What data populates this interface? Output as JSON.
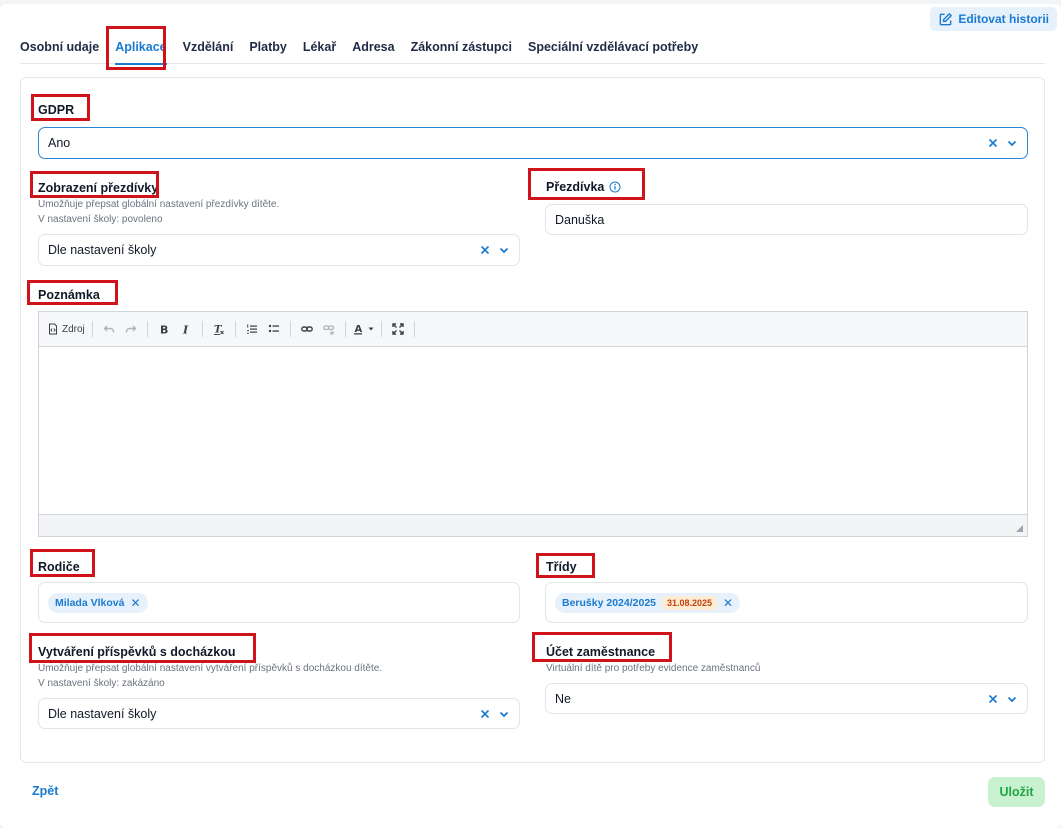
{
  "header": {
    "edit_history_label": "Editovat historii"
  },
  "tabs": [
    {
      "label": "Osobní udaje",
      "active": false
    },
    {
      "label": "Aplikace",
      "active": true
    },
    {
      "label": "Vzdělání",
      "active": false
    },
    {
      "label": "Platby",
      "active": false
    },
    {
      "label": "Lékař",
      "active": false
    },
    {
      "label": "Adresa",
      "active": false
    },
    {
      "label": "Zákonní zástupci",
      "active": false
    },
    {
      "label": "Speciální vzdělávací potřeby",
      "active": false
    }
  ],
  "gdpr": {
    "label": "GDPR",
    "value": "Ano"
  },
  "nickname_display": {
    "label": "Zobrazení přezdívky",
    "hint1": "Umožňuje přepsat globální nastavení přezdívky dítěte.",
    "hint2": "V nastavení školy: povoleno",
    "value": "Dle nastavení školy"
  },
  "nickname": {
    "label": "Přezdívka",
    "value": "Danuška"
  },
  "note": {
    "label": "Poznámka",
    "toolbar_source_label": "Zdroj",
    "content": ""
  },
  "parents": {
    "label": "Rodiče",
    "chips": [
      "Milada Vlková"
    ]
  },
  "classes": {
    "label": "Třídy",
    "chip_label": "Berušky 2024/2025",
    "chip_date": "31.08.2025"
  },
  "attendance_posts": {
    "label": "Vytváření příspěvků s docházkou",
    "hint1": "Umožňuje přepsat globální nastavení vytváření příspěvků s docházkou dítěte.",
    "hint2": "V nastavení školy: zakázáno",
    "value": "Dle nastavení školy"
  },
  "employee_account": {
    "label": "Účet zaměstnance",
    "hint": "Virtuální dítě pro potřeby evidence zaměstnanců",
    "value": "Ne"
  },
  "footer": {
    "back_label": "Zpět",
    "save_label": "Uložit"
  },
  "colors": {
    "accent": "#1a7bd1",
    "highlight": "#d0121b",
    "save_bg": "#c8f2cf",
    "save_text": "#22a447"
  }
}
